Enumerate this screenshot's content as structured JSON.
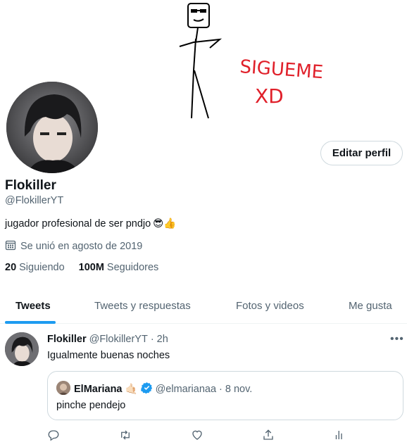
{
  "banner": {
    "doodle_text_line1": "SIGUEME",
    "doodle_text_line2": "XD"
  },
  "profile": {
    "edit_button": "Editar perfil",
    "name": "Flokiller",
    "handle": "@FlokillerYT",
    "bio_text": "jugador profesional de ser pndjo",
    "bio_emojis": "😎👍",
    "joined": "Se unió en agosto de 2019",
    "following_count": "20",
    "following_label": "Siguiendo",
    "followers_count": "100M",
    "followers_label": "Seguidores"
  },
  "tabs": [
    {
      "label": "Tweets"
    },
    {
      "label": "Tweets y respuestas"
    },
    {
      "label": "Fotos y videos"
    },
    {
      "label": "Me gusta"
    }
  ],
  "tweet": {
    "author_name": "Flokiller",
    "author_handle": "@FlokillerYT",
    "separator": "·",
    "time": "2h",
    "text": "Igualmente buenas noches",
    "more": "•••",
    "quote": {
      "author_name": "ElMariana",
      "author_emoji": "🤙🏻",
      "author_handle": "@elmarianaa",
      "separator": "·",
      "date": "8 nov.",
      "text": "pinche pendejo"
    }
  },
  "colors": {
    "accent": "#1d9bf0",
    "secondary_text": "#536471",
    "doodle_red": "#e0202a"
  }
}
